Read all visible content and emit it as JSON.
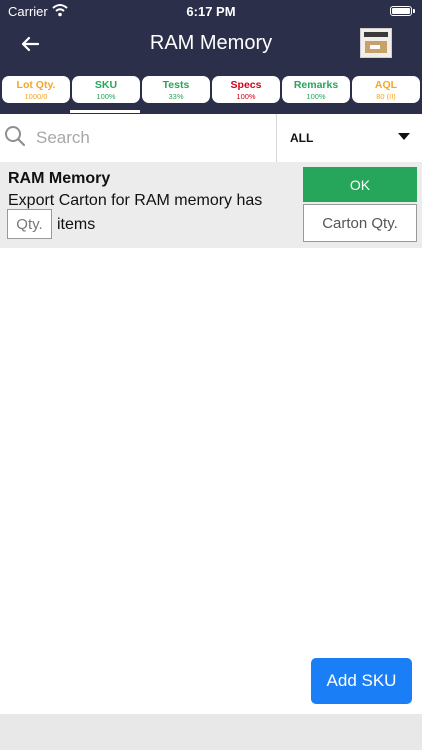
{
  "status_bar": {
    "carrier": "Carrier",
    "time": "6:17 PM"
  },
  "nav": {
    "title": "RAM Memory",
    "back_icon": "arrow-left"
  },
  "colors": {
    "header_bg": "#2b2f4a",
    "ok_green": "#26a65b",
    "add_sku_blue": "#1a7ff6",
    "tab_orange": "#f5a623",
    "tab_green": "#26a65b",
    "tab_red": "#d0021b"
  },
  "tabs": [
    {
      "label": "Lot Qty.",
      "value": "1000/0",
      "color": "#f5a623"
    },
    {
      "label": "SKU",
      "value": "100%",
      "color": "#26a65b",
      "selected": true
    },
    {
      "label": "Tests",
      "value": "33%",
      "color": "#26a65b"
    },
    {
      "label": "Specs",
      "value": "100%",
      "color": "#d0021b"
    },
    {
      "label": "Remarks",
      "value": "100%",
      "color": "#26a65b"
    },
    {
      "label": "AQL",
      "value": "80 (II)",
      "color": "#f5a623"
    }
  ],
  "search": {
    "placeholder": "Search",
    "value": ""
  },
  "filter": {
    "selected": "ALL"
  },
  "card": {
    "title": "RAM Memory",
    "text": "Export Carton for RAM memory has",
    "qty_placeholder": "Qty.",
    "items_label": "items",
    "ok_label": "OK",
    "carton_placeholder": "Carton Qty."
  },
  "add_sku_label": "Add SKU"
}
